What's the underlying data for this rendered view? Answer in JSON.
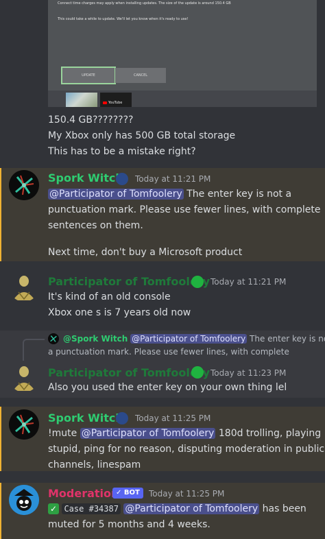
{
  "embed": {
    "line1": "Connect time charges may apply when installing updates. The size of the update is around 150.4 GB",
    "line2": "This could take a while to update. We'll let you know when it's ready to use!",
    "update_label": "UPDATE",
    "cancel_label": "CANCEL",
    "thumb2_label": "YouTube"
  },
  "msg0": {
    "lines": [
      "150.4 GB????????",
      "My Xbox only has 500 GB total storage",
      "This has to be a mistake right?"
    ]
  },
  "msg1": {
    "author": "Spork Witch",
    "time": "Today at 11:21 PM",
    "mention": "@Participator of Tomfoolery",
    "text1": " The enter key is not a",
    "text2": "punctuation mark. Please use fewer lines, with complete",
    "text3": "sentences on them.",
    "text4": "Next time, don't buy a Microsoft product"
  },
  "msg2": {
    "author": "Participator of Tomfoolery",
    "time": "Today at 11:21 PM",
    "line1": "It's kind of an old console",
    "line2": "Xbox one s is 7 years old now"
  },
  "msg3": {
    "reply_author": "@Spork Witch",
    "reply_mention": "@Participator of Tomfoolery",
    "reply_text1": " The enter key is not",
    "reply_text2": "a punctuation mark. Please use fewer lines, with complete",
    "author": "Participator of Tomfoolery",
    "time": "Today at 11:23 PM",
    "line1": "Also you used the enter key on your own thing lel"
  },
  "msg4": {
    "author": "Spork Witch",
    "time": "Today at 11:25 PM",
    "cmd": "!mute ",
    "mention": "@Participator of Tomfoolery",
    "text1": " 180d trolling, playing",
    "text2": "stupid, ping for no reason, disputing moderation in public",
    "text3": "channels, linespam"
  },
  "msg5": {
    "author": "Moderation",
    "bot_label": "✓ BOT",
    "time": "Today at 11:25 PM",
    "check": "✓",
    "case": "Case",
    "case_id": "#34387",
    "mention": "@Participator of Tomfoolery",
    "text1": " has been",
    "text2": "muted for 5 months and 4 weeks."
  },
  "colors": {
    "background": "#313338",
    "highlight": "#3f3c35",
    "highlight_bar": "#f0b232",
    "mention": "#4a4f8c",
    "green_name": "#2ecc71",
    "pink_name": "#e0336a"
  }
}
